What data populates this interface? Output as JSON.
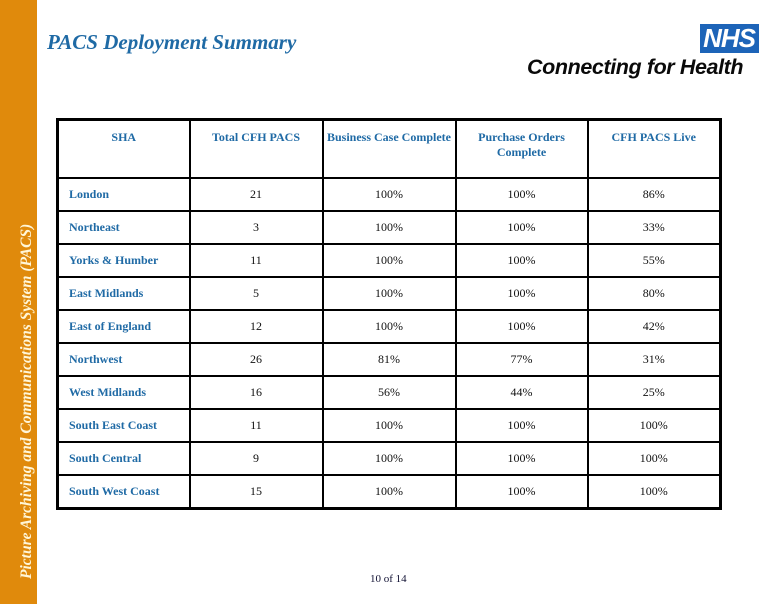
{
  "sidebar": {
    "text": "Picture Archiving and Communications System (PACS)"
  },
  "header": {
    "title": "PACS Deployment Summary",
    "logo": {
      "badge": "NHS",
      "text": "Connecting for Health"
    }
  },
  "colors": {
    "sidebar": "#e08a0c",
    "title": "#1f6aa5",
    "nhs_blue": "#1d64b8"
  },
  "table": {
    "columns": [
      "SHA",
      "Total CFH PACS",
      "Business Case Complete",
      "Purchase Orders Complete",
      "CFH PACS Live"
    ],
    "rows": [
      [
        "London",
        "21",
        "100%",
        "100%",
        "86%"
      ],
      [
        "Northeast",
        "3",
        "100%",
        "100%",
        "33%"
      ],
      [
        "Yorks & Humber",
        "11",
        "100%",
        "100%",
        "55%"
      ],
      [
        "East Midlands",
        "5",
        "100%",
        "100%",
        "80%"
      ],
      [
        "East of England",
        "12",
        "100%",
        "100%",
        "42%"
      ],
      [
        "Northwest",
        "26",
        "81%",
        "77%",
        "31%"
      ],
      [
        "West Midlands",
        "16",
        "56%",
        "44%",
        "25%"
      ],
      [
        "South East Coast",
        "11",
        "100%",
        "100%",
        "100%"
      ],
      [
        "South Central",
        "9",
        "100%",
        "100%",
        "100%"
      ],
      [
        "South West Coast",
        "15",
        "100%",
        "100%",
        "100%"
      ]
    ]
  },
  "footer": {
    "page": "10 of 14"
  }
}
